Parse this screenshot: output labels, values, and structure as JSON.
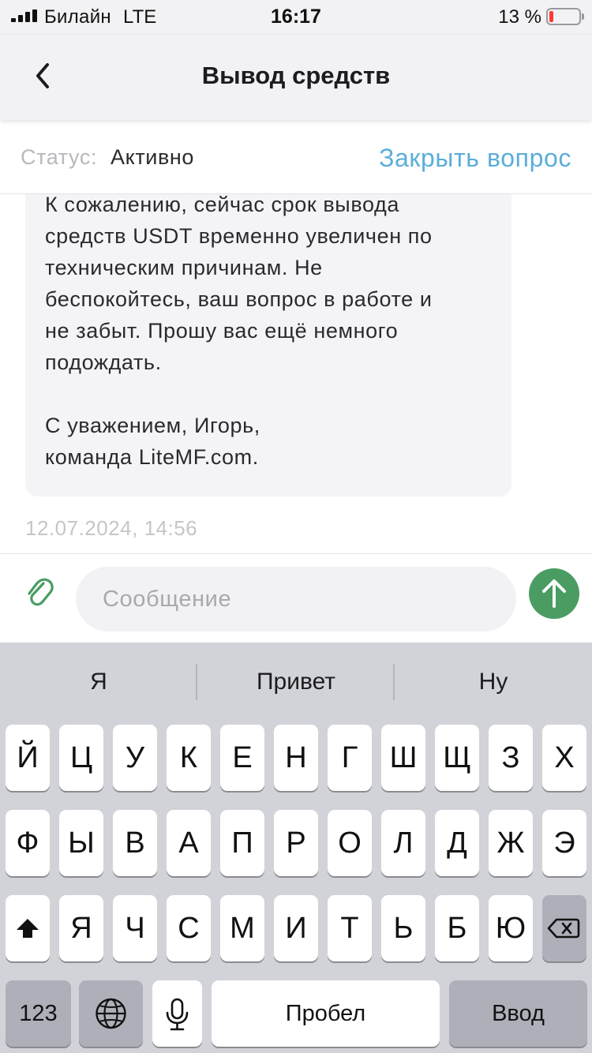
{
  "status_bar": {
    "carrier": "Билайн",
    "network": "LTE",
    "time": "16:17",
    "battery_percent": "13 %",
    "battery_level": 0.13,
    "battery_color": "#ff3b30"
  },
  "nav": {
    "back_icon": "chevron-left-icon",
    "title": "Вывод средств"
  },
  "ticket": {
    "status_label": "Статус:",
    "status_value": "Активно",
    "close_label": "Закрыть вопрос"
  },
  "message": {
    "lines": [
      "К сожалению, сейчас срок  вывода",
      "средств USDT временно увеличен по",
      "техническим причинам. Не",
      "беспокойтесь, ваш вопрос в работе и",
      "не забыт. Прошу вас ещё немного",
      "подождать.",
      "",
      "С уважением, Игорь,",
      "команда LiteMF.com."
    ],
    "timestamp": "12.07.2024, 14:56"
  },
  "composer": {
    "attach_icon": "paperclip-icon",
    "placeholder": "Сообщение",
    "send_icon": "arrow-up-icon",
    "send_color": "#4a9c63"
  },
  "keyboard": {
    "suggestions": [
      "Я",
      "Привет",
      "Ну"
    ],
    "row1": [
      "Й",
      "Ц",
      "У",
      "К",
      "Е",
      "Н",
      "Г",
      "Ш",
      "Щ",
      "З",
      "Х"
    ],
    "row2": [
      "Ф",
      "Ы",
      "В",
      "А",
      "П",
      "Р",
      "О",
      "Л",
      "Д",
      "Ж",
      "Э"
    ],
    "row3": [
      "Я",
      "Ч",
      "С",
      "М",
      "И",
      "Т",
      "Ь",
      "Б",
      "Ю"
    ],
    "shift_icon": "shift-icon",
    "backspace_icon": "backspace-icon",
    "numbers_label": "123",
    "globe_icon": "globe-icon",
    "mic_icon": "microphone-icon",
    "space_label": "Пробел",
    "return_label": "Ввод"
  }
}
